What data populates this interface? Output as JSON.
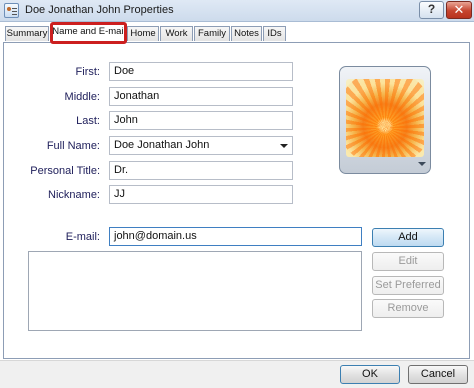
{
  "window": {
    "title": "Doe Jonathan John Properties",
    "help_label": "?",
    "close_label": "✕"
  },
  "tabs": [
    {
      "label": "Summary",
      "active": false
    },
    {
      "label": "Name and E-mail",
      "active": true
    },
    {
      "label": "Home",
      "active": false
    },
    {
      "label": "Work",
      "active": false
    },
    {
      "label": "Family",
      "active": false
    },
    {
      "label": "Notes",
      "active": false
    },
    {
      "label": "IDs",
      "active": false
    }
  ],
  "form": {
    "first": {
      "label": "First:",
      "value": "Doe"
    },
    "middle": {
      "label": "Middle:",
      "value": "Jonathan"
    },
    "last": {
      "label": "Last:",
      "value": "John"
    },
    "full_name": {
      "label": "Full Name:",
      "value": "Doe Jonathan John"
    },
    "personal_title": {
      "label": "Personal Title:",
      "value": "Dr."
    },
    "nickname": {
      "label": "Nickname:",
      "value": "JJ"
    },
    "email": {
      "label": "E-mail:",
      "value": "john@domain.us"
    }
  },
  "email_list": [],
  "buttons": {
    "add": "Add",
    "edit": "Edit",
    "set_preferred": "Set Preferred",
    "remove": "Remove",
    "ok": "OK",
    "cancel": "Cancel"
  },
  "colors": {
    "highlight": "#cc1f1f",
    "label_text": "#1e1e5a"
  }
}
